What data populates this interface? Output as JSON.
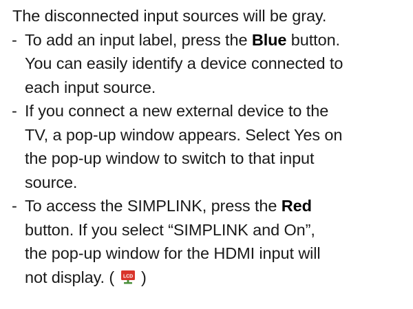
{
  "document": {
    "intro": "The disconnected input sources will be gray.",
    "bullets": [
      {
        "dash": "-",
        "segments": [
          {
            "text": "To add an input label, press the "
          },
          {
            "text": "Blue",
            "bold": true
          },
          {
            "text": " button. You can easily identify a device connected to each input source."
          }
        ]
      },
      {
        "dash": "-",
        "segments": [
          {
            "text": "If you connect a new external device to the TV, a pop-up window appears. Select Yes on the pop-up window to switch to that input source."
          }
        ]
      },
      {
        "dash": "-",
        "segments": [
          {
            "text": "To access the SIMPLINK, press the "
          },
          {
            "text": "Red",
            "bold": true
          },
          {
            "text": " button. If you select “SIMPLINK and On”, the pop-up window for the HDMI input will not display. ("
          },
          {
            "icon": "lcd-tv-icon",
            "label": "LCD"
          },
          {
            "text": ")"
          }
        ]
      }
    ]
  },
  "icon_colors": {
    "lcd_screen": "#d9342b",
    "lcd_stand": "#4a8f3a"
  }
}
